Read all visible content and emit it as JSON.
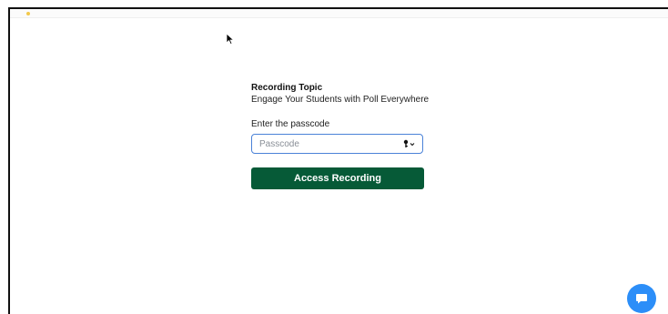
{
  "recording": {
    "topic_label": "Recording Topic",
    "topic_name": "Engage Your Students with Poll Everywhere"
  },
  "passcode": {
    "label": "Enter the passcode",
    "placeholder": "Passcode",
    "value": "",
    "icon": "key-icon"
  },
  "actions": {
    "access_label": "Access Recording"
  },
  "chat": {
    "icon": "chat-bubble-icon"
  },
  "colors": {
    "primary_button": "#065a37",
    "field_border": "#4a82d8",
    "chat_button": "#2c8ef8"
  }
}
